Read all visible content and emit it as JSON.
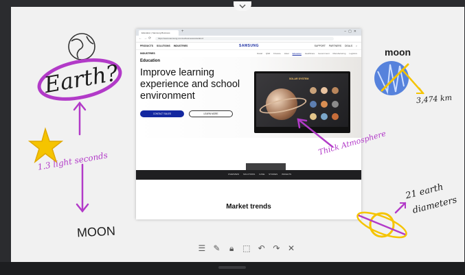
{
  "browser": {
    "tab_title": "Education | Samsung Business",
    "url": "https://www.samsung.com/us/business/education/",
    "nav_left": [
      "PRODUCTS",
      "SOLUTIONS",
      "INDUSTRIES"
    ],
    "logo": "SAMSUNG",
    "nav_right": [
      "SUPPORT",
      "PARTNERS",
      "DEALS"
    ],
    "subnav_title": "INDUSTRIES",
    "subnav_links": [
      "Retail",
      "QSR",
      "Finance",
      "Hotel",
      "Education",
      "Healthcare",
      "Government",
      "Manufacturing",
      "Logistics"
    ],
    "hero_eyebrow": "Education",
    "hero_title": "Improve learning experience and school environment",
    "primary_cta": "CONTACT SALES",
    "secondary_cta": "LEARN MORE",
    "monitor_title": "SOLAR SYSTEM",
    "band_links": [
      "OVERVIEW",
      "SOLUTIONS",
      "CASE STUDIES",
      "INSIGHTS"
    ],
    "section_title": "Market trends"
  },
  "annotations": {
    "earth_label": "Earth?",
    "moon_label_top": "moon",
    "moon_distance": "3,474 km",
    "light_seconds": "1.3 light seconds",
    "moon_label_bottom": "MOON",
    "atmosphere": "Thick Atmosphere",
    "saturn_diameter_line1": "21 earth",
    "saturn_diameter_line2": "diameters"
  },
  "toolbar": {
    "tools": [
      {
        "name": "menu",
        "glyph": "☰"
      },
      {
        "name": "pen",
        "glyph": "✎"
      },
      {
        "name": "lock",
        "glyph": "🔒︎"
      },
      {
        "name": "capture",
        "glyph": "⬚"
      },
      {
        "name": "undo",
        "glyph": "↶"
      },
      {
        "name": "redo",
        "glyph": "↷"
      },
      {
        "name": "close",
        "glyph": "✕"
      }
    ]
  },
  "colors": {
    "magenta_ink": "#b23ac8",
    "purple_ink": "#7b3fb0",
    "yellow_ink": "#f5c400",
    "blue_ink": "#3b6fd8",
    "samsung_blue": "#1428a0"
  }
}
